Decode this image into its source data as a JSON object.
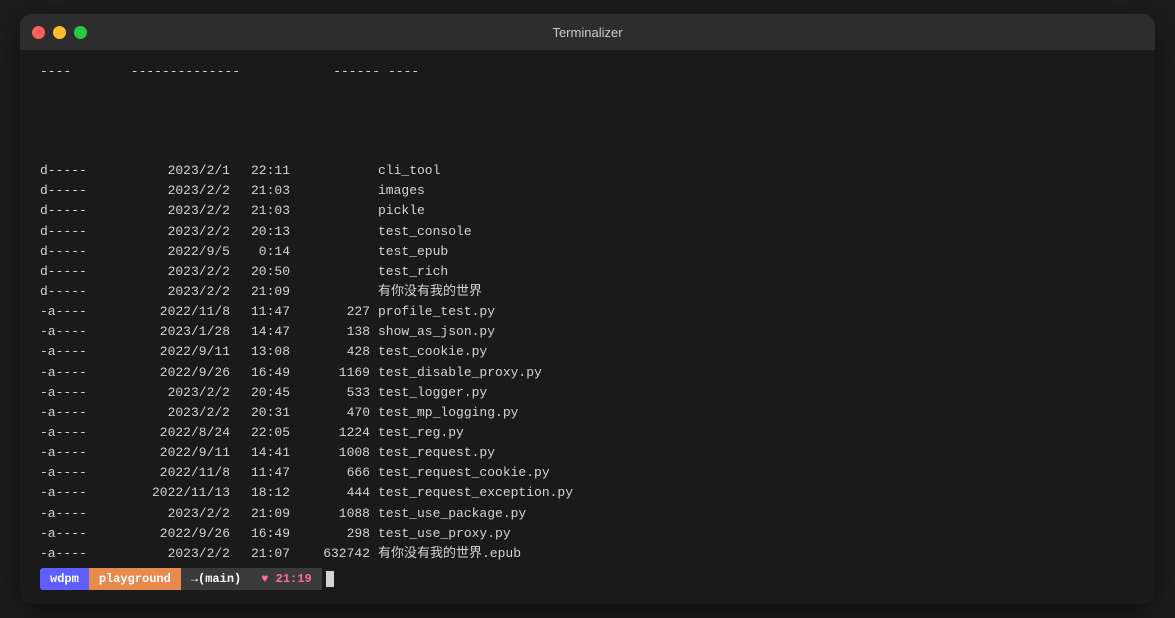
{
  "window": {
    "title": "Terminalizer"
  },
  "header_row": {
    "dashes1": "----",
    "dashes2": "--------------",
    "dashes3": "------",
    "dashes4": "----"
  },
  "rows": [
    {
      "mode": "d-----",
      "date": "2023/2/1",
      "time": "22:11",
      "size": "",
      "name": "cli_tool"
    },
    {
      "mode": "d-----",
      "date": "2023/2/2",
      "time": "21:03",
      "size": "",
      "name": "images"
    },
    {
      "mode": "d-----",
      "date": "2023/2/2",
      "time": "21:03",
      "size": "",
      "name": "pickle"
    },
    {
      "mode": "d-----",
      "date": "2023/2/2",
      "time": "20:13",
      "size": "",
      "name": "test_console"
    },
    {
      "mode": "d-----",
      "date": "2022/9/5",
      "time": " 0:14",
      "size": "",
      "name": "test_epub"
    },
    {
      "mode": "d-----",
      "date": "2023/2/2",
      "time": "20:50",
      "size": "",
      "name": "test_rich"
    },
    {
      "mode": "d-----",
      "date": "2023/2/2",
      "time": "21:09",
      "size": "",
      "name": "有你没有我的世界"
    },
    {
      "mode": "-a----",
      "date": "2022/11/8",
      "time": "11:47",
      "size": "227",
      "name": "profile_test.py"
    },
    {
      "mode": "-a----",
      "date": "2023/1/28",
      "time": "14:47",
      "size": "138",
      "name": "show_as_json.py"
    },
    {
      "mode": "-a----",
      "date": "2022/9/11",
      "time": "13:08",
      "size": "428",
      "name": "test_cookie.py"
    },
    {
      "mode": "-a----",
      "date": "2022/9/26",
      "time": "16:49",
      "size": "1169",
      "name": "test_disable_proxy.py"
    },
    {
      "mode": "-a----",
      "date": "2023/2/2",
      "time": "20:45",
      "size": "533",
      "name": "test_logger.py"
    },
    {
      "mode": "-a----",
      "date": "2023/2/2",
      "time": "20:31",
      "size": "470",
      "name": "test_mp_logging.py"
    },
    {
      "mode": "-a----",
      "date": "2022/8/24",
      "time": "22:05",
      "size": "1224",
      "name": "test_reg.py"
    },
    {
      "mode": "-a----",
      "date": "2022/9/11",
      "time": "14:41",
      "size": "1008",
      "name": "test_request.py"
    },
    {
      "mode": "-a----",
      "date": "2022/11/8",
      "time": "11:47",
      "size": "666",
      "name": "test_request_cookie.py"
    },
    {
      "mode": "-a----",
      "date": "2022/11/13",
      "time": "18:12",
      "size": "444",
      "name": "test_request_exception.py"
    },
    {
      "mode": "-a----",
      "date": "2023/2/2",
      "time": "21:09",
      "size": "1088",
      "name": "test_use_package.py"
    },
    {
      "mode": "-a----",
      "date": "2022/9/26",
      "time": "16:49",
      "size": "298",
      "name": "test_use_proxy.py"
    },
    {
      "mode": "-a----",
      "date": "2023/2/2",
      "time": "21:07",
      "size": "632742",
      "name": "有你没有我的世界.epub"
    }
  ],
  "statusbar": {
    "wdpm": "wdpm",
    "playground": "playground",
    "arrow": "→(main)",
    "heart": "♥",
    "time": "21:19"
  }
}
